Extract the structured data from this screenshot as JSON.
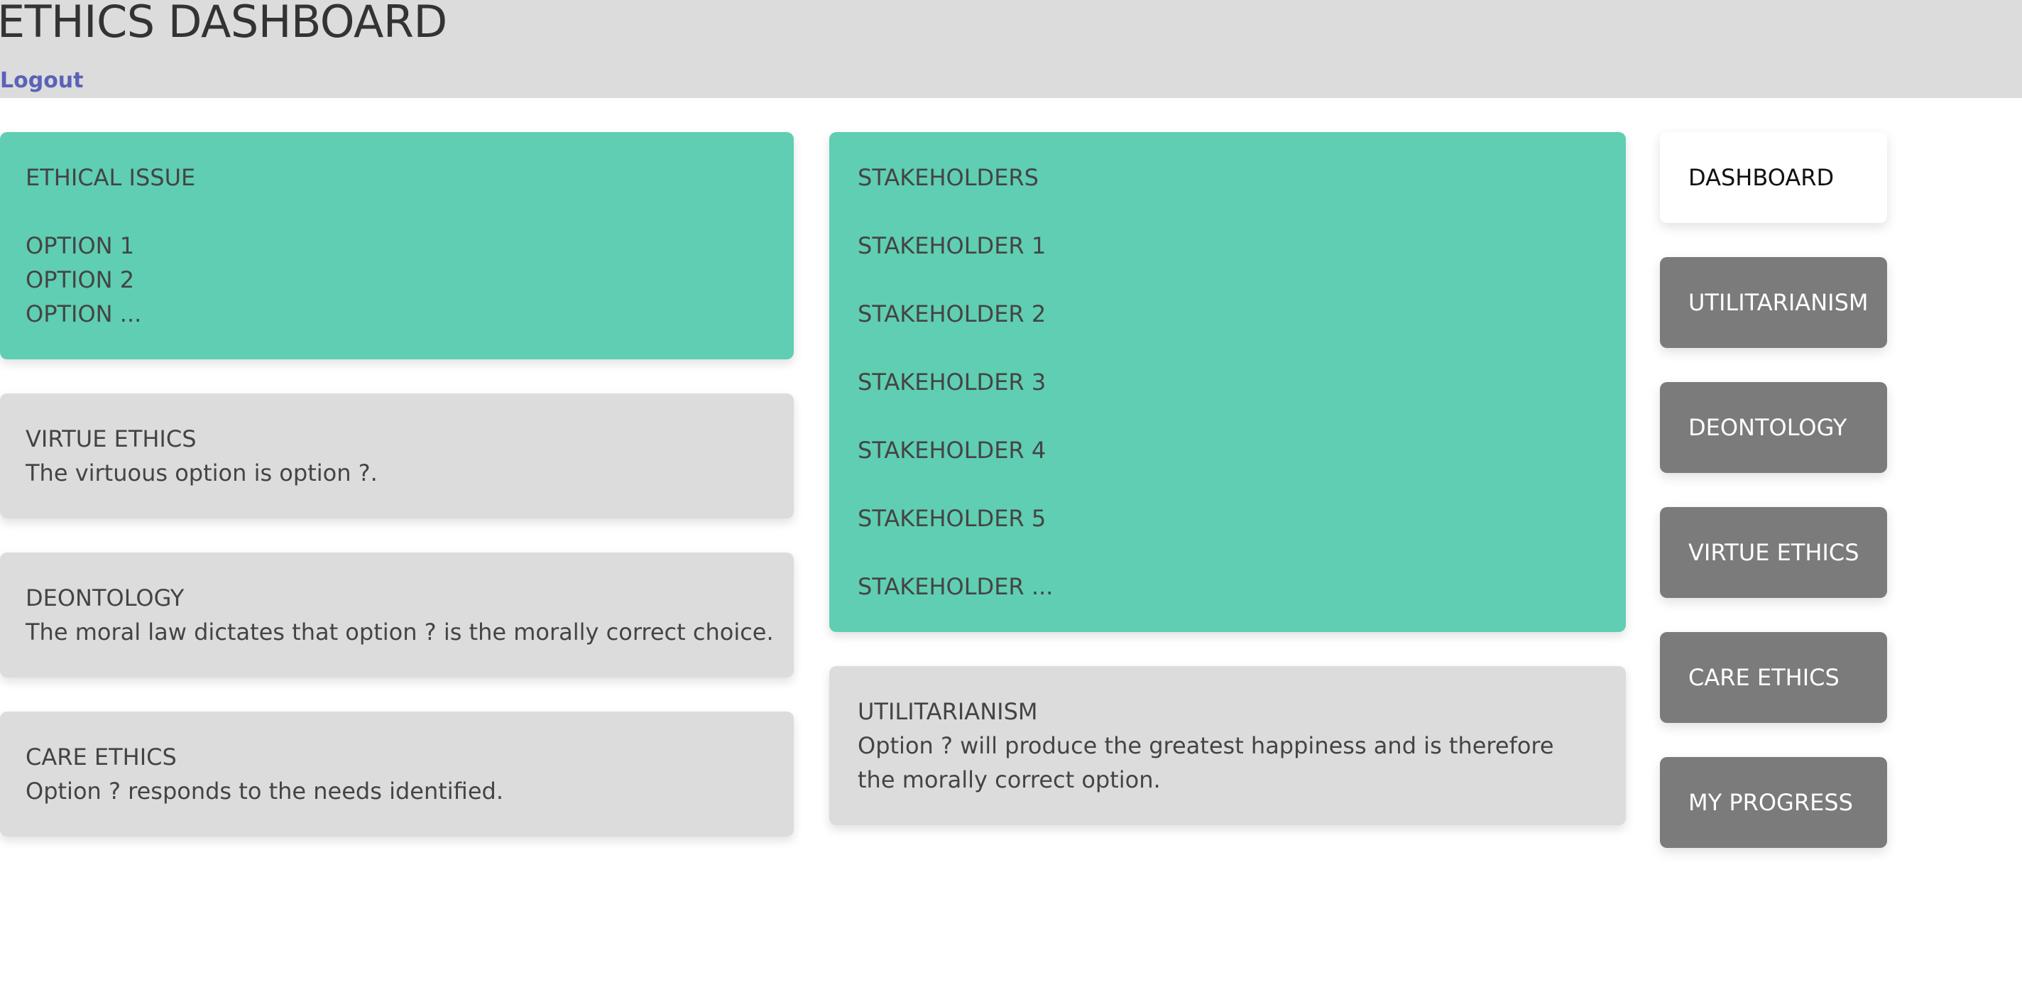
{
  "header": {
    "title": "ETHICS DASHBOARD",
    "logout_label": "Logout"
  },
  "ethical_issue": {
    "heading": "ETHICAL ISSUE",
    "options": [
      "OPTION 1",
      "OPTION 2",
      "OPTION ..."
    ]
  },
  "virtue_ethics": {
    "heading": "VIRTUE ETHICS",
    "text": "The virtuous option is option ?."
  },
  "deontology": {
    "heading": "DEONTOLOGY",
    "text": "The moral law dictates that option ? is the morally correct choice."
  },
  "care_ethics": {
    "heading": "CARE ETHICS",
    "text": "Option ? responds to the needs identified."
  },
  "stakeholders": {
    "heading": "STAKEHOLDERS",
    "items": [
      "STAKEHOLDER 1",
      "STAKEHOLDER 2",
      "STAKEHOLDER 3",
      "STAKEHOLDER 4",
      "STAKEHOLDER 5",
      "STAKEHOLDER ..."
    ]
  },
  "utilitarianism": {
    "heading": "UTILITARIANISM",
    "text": "Option ? will produce the greatest happiness and is therefore the morally correct option."
  },
  "nav": {
    "items": [
      {
        "label": "DASHBOARD",
        "active": true
      },
      {
        "label": "UTILITARIANISM",
        "active": false
      },
      {
        "label": "DEONTOLOGY",
        "active": false
      },
      {
        "label": "VIRTUE ETHICS",
        "active": false
      },
      {
        "label": "CARE ETHICS",
        "active": false
      },
      {
        "label": "MY PROGRESS",
        "active": false
      }
    ]
  },
  "colors": {
    "header_bg": "#dcdcdc",
    "accent_green": "#5fceb3",
    "panel_gray": "#dcdcdc",
    "nav_inactive": "#7b7b7b",
    "nav_active": "#ffffff",
    "link": "#5a62b8"
  }
}
